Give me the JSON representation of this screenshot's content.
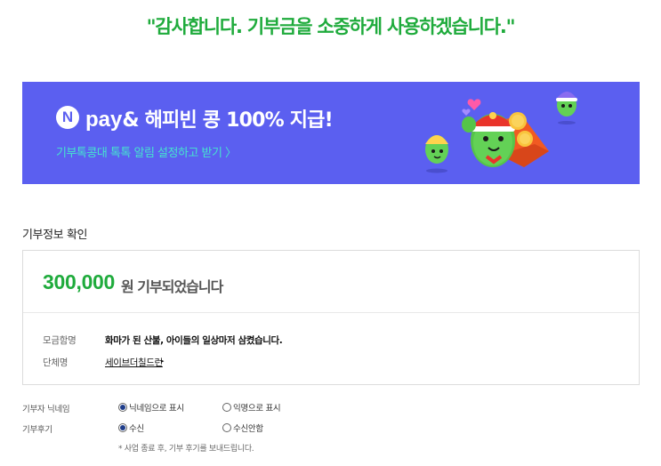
{
  "header": {
    "thanks_message": "\"감사합니다. 기부금을 소중하게 사용하겠습니다.\""
  },
  "banner": {
    "npay_letter": "N",
    "pay_word": "pay",
    "title_rest": "& 해피빈 콩 100% 지급!",
    "subtitle": "기부톡콩대 톡톡 알림 설정하고 받기 〉",
    "colors": {
      "background": "#5b5ff0",
      "subtitle": "#46e4cf"
    }
  },
  "donation_info": {
    "section_title": "기부정보 확인",
    "amount": "300,000",
    "amount_suffix": "원 기부되었습니다",
    "campaign_label": "모금함명",
    "campaign_value": "화마가 된 산불, 아이들의 일상마저 삼켰습니다.",
    "org_label": "단체명",
    "org_value": "세이브더칠드런",
    "org_arrow": "▸"
  },
  "options": {
    "nickname_label": "기부자 닉네임",
    "nickname_choices": [
      {
        "label": "닉네임으로 표시",
        "selected": true
      },
      {
        "label": "익명으로 표시",
        "selected": false
      }
    ],
    "review_label": "기부후기",
    "review_choices": [
      {
        "label": "수신",
        "selected": true
      },
      {
        "label": "수신안함",
        "selected": false
      }
    ],
    "note": "* 사업 종료 후, 기부 후기를 보내드립니다."
  },
  "accent_color": "#1fab3c"
}
